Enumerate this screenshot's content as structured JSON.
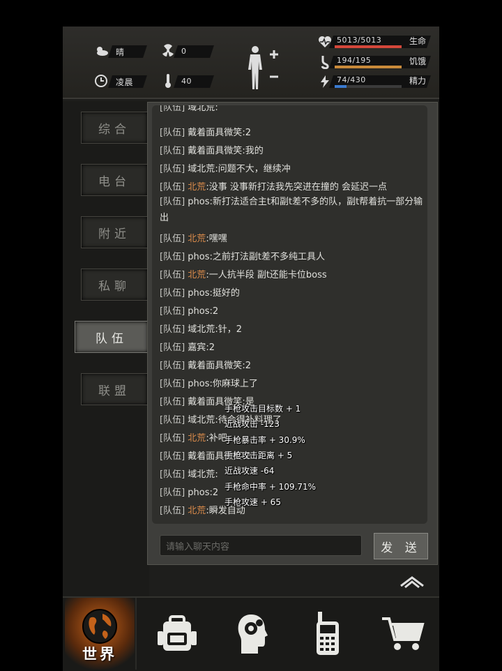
{
  "status": {
    "weather": "晴",
    "radiation": "0",
    "time_of_day": "凌晨",
    "temperature": "40",
    "health": {
      "value": "5013/5013",
      "label": "生命",
      "fraction": 1.0,
      "color": "#d4473a"
    },
    "hunger": {
      "value": "194/195",
      "label": "饥饿",
      "fraction": 0.995,
      "color": "#c98a3a"
    },
    "energy": {
      "value": "74/430",
      "label": "精力",
      "fraction": 0.172,
      "color": "#3a7ad0"
    }
  },
  "tabs": [
    {
      "label": "综合",
      "active": false
    },
    {
      "label": "电台",
      "active": false
    },
    {
      "label": "附近",
      "active": false
    },
    {
      "label": "私聊",
      "active": false
    },
    {
      "label": "队伍",
      "active": true
    },
    {
      "label": "联盟",
      "active": false
    }
  ],
  "chat": {
    "cut_line": {
      "tag": "[队伍]",
      "name": "域北荒",
      "text": ":"
    },
    "messages": [
      {
        "tag": "[队伍]",
        "name": "戴着面具微笑",
        "orange": false,
        "text": ":2"
      },
      {
        "tag": "[队伍]",
        "name": "戴着面具微笑",
        "orange": false,
        "text": ":我的"
      },
      {
        "tag": "[队伍]",
        "name": "域北荒",
        "orange": false,
        "text": ":问题不大，继续冲"
      },
      {
        "tag": "[队伍]",
        "name": "北荒",
        "orange": true,
        "text": ":没事 没事新打法我先突进在撞的 会延迟一点"
      },
      {
        "tag": "[队伍]",
        "name": "phos",
        "orange": false,
        "text": ":新打法适合主t和副t差不多的队，副t帮着抗一部分输出"
      },
      {
        "tag": "[队伍]",
        "name": "北荒",
        "orange": true,
        "text": ":嘿嘿"
      },
      {
        "tag": "[队伍]",
        "name": "phos",
        "orange": false,
        "text": ":之前打法副t差不多纯工具人"
      },
      {
        "tag": "[队伍]",
        "name": "北荒",
        "orange": true,
        "text": ":一人抗半段 副t还能卡位boss"
      },
      {
        "tag": "[队伍]",
        "name": "phos",
        "orange": false,
        "text": ":挺好的"
      },
      {
        "tag": "[队伍]",
        "name": "phos",
        "orange": false,
        "text": ":2"
      },
      {
        "tag": "[队伍]",
        "name": "域北荒",
        "orange": false,
        "text": ":针，2"
      },
      {
        "tag": "[队伍]",
        "name": "嘉宾",
        "orange": false,
        "text": ":2"
      },
      {
        "tag": "[队伍]",
        "name": "戴着面具微笑",
        "orange": false,
        "text": ":2"
      },
      {
        "tag": "[队伍]",
        "name": "phos",
        "orange": false,
        "text": ":你麻球上了"
      },
      {
        "tag": "[队伍]",
        "name": "戴着面具微笑",
        "orange": false,
        "text": ":是"
      },
      {
        "tag": "[队伍]",
        "name": "域北荒",
        "orange": false,
        "text": ":待会得补料理了"
      },
      {
        "tag": "[队伍]",
        "name": "北荒",
        "orange": true,
        "text": ":补吧"
      },
      {
        "tag": "[队伍]",
        "name": "戴着面具微笑",
        "orange": false,
        "text": ":2"
      },
      {
        "tag": "[队伍]",
        "name": "域北荒",
        "orange": false,
        "text": ":"
      },
      {
        "tag": "[队伍]",
        "name": "phos",
        "orange": false,
        "text": ":2"
      },
      {
        "tag": "[队伍]",
        "name": "北荒",
        "orange": true,
        "text": ":瞬发自动"
      }
    ],
    "input_placeholder": "请输入聊天内容",
    "send_label": "发 送"
  },
  "stat_popup": [
    "手枪攻击目标数 + 1",
    "近战攻击 -123",
    "手枪暴击率 + 30.9%",
    "手枪攻击距离 + 5",
    "近战攻速 -64",
    "手枪命中率 + 109.71%",
    "手枪攻速 + 65"
  ],
  "bottom_nav": [
    {
      "label": "世界",
      "icon": "globe-icon",
      "active": true
    },
    {
      "label": "",
      "icon": "backpack-icon",
      "active": false
    },
    {
      "label": "",
      "icon": "head-gear-icon",
      "active": false
    },
    {
      "label": "",
      "icon": "walkie-talkie-icon",
      "active": false
    },
    {
      "label": "",
      "icon": "cart-icon",
      "active": false
    }
  ]
}
